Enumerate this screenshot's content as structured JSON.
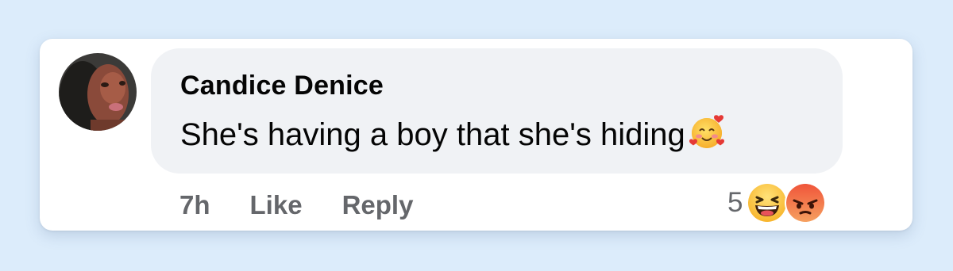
{
  "comment": {
    "author": "Candice Denice",
    "text": "She's having a boy that she's hiding",
    "inline_emoji": "smiling-face-with-hearts-icon"
  },
  "actions": {
    "time": "7h",
    "like_label": "Like",
    "reply_label": "Reply"
  },
  "reactions": {
    "count": "5",
    "icons": [
      "haha-reaction-icon",
      "angry-reaction-icon"
    ]
  },
  "colors": {
    "page_background": "#dcecfb",
    "bubble": "#f0f2f5",
    "text": "#050505",
    "secondary_text": "#65676b"
  }
}
